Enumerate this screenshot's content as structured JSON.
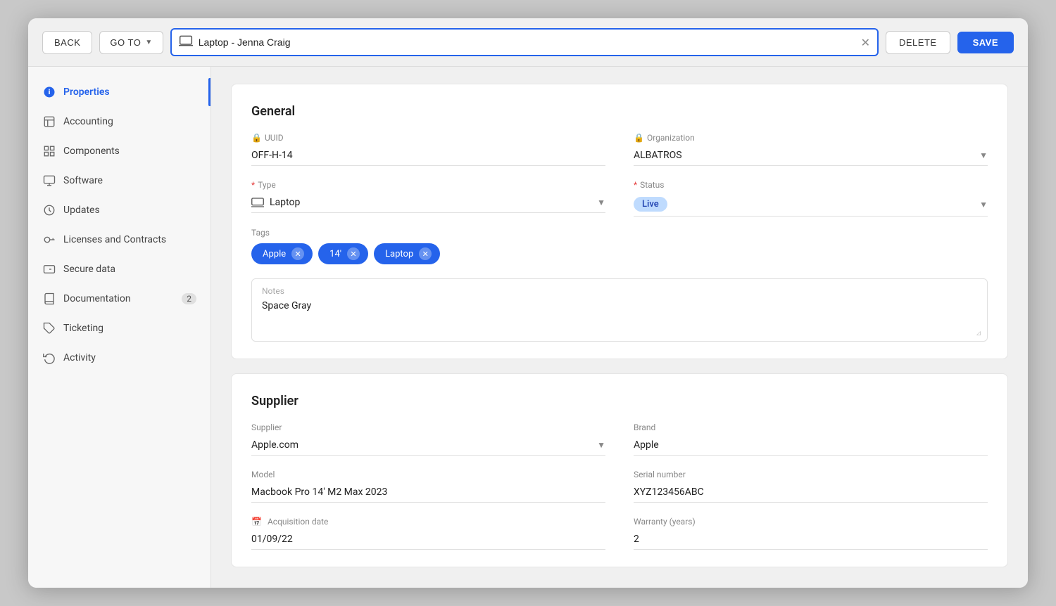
{
  "topbar": {
    "back_label": "BACK",
    "goto_label": "GO TO",
    "item_name": "Laptop - Jenna Craig",
    "delete_label": "DELETE",
    "save_label": "SAVE"
  },
  "sidebar": {
    "items": [
      {
        "id": "properties",
        "label": "Properties",
        "icon": "info-icon",
        "active": true,
        "badge": null
      },
      {
        "id": "accounting",
        "label": "Accounting",
        "icon": "calculator-icon",
        "active": false,
        "badge": null
      },
      {
        "id": "components",
        "label": "Components",
        "icon": "grid-icon",
        "active": false,
        "badge": null
      },
      {
        "id": "software",
        "label": "Software",
        "icon": "monitor-icon",
        "active": false,
        "badge": null
      },
      {
        "id": "updates",
        "label": "Updates",
        "icon": "clock-icon",
        "active": false,
        "badge": null
      },
      {
        "id": "licenses",
        "label": "Licenses and Contracts",
        "icon": "key-icon",
        "active": false,
        "badge": null
      },
      {
        "id": "secure-data",
        "label": "Secure data",
        "icon": "id-icon",
        "active": false,
        "badge": null
      },
      {
        "id": "documentation",
        "label": "Documentation",
        "icon": "book-icon",
        "active": false,
        "badge": "2"
      },
      {
        "id": "ticketing",
        "label": "Ticketing",
        "icon": "tag-icon",
        "active": false,
        "badge": null
      },
      {
        "id": "activity",
        "label": "Activity",
        "icon": "history-icon",
        "active": false,
        "badge": null
      }
    ]
  },
  "general": {
    "title": "General",
    "uuid_label": "UUID",
    "uuid_value": "OFF-H-14",
    "organization_label": "Organization",
    "organization_value": "ALBATROS",
    "type_label": "Type",
    "type_value": "Laptop",
    "status_label": "Status",
    "status_value": "Live",
    "tags_label": "Tags",
    "tags": [
      {
        "label": "Apple"
      },
      {
        "label": "14'"
      },
      {
        "label": "Laptop"
      }
    ],
    "notes_label": "Notes",
    "notes_value": "Space Gray"
  },
  "supplier": {
    "title": "Supplier",
    "supplier_label": "Supplier",
    "supplier_value": "Apple.com",
    "brand_label": "Brand",
    "brand_value": "Apple",
    "model_label": "Model",
    "model_value": "Macbook Pro 14' M2 Max 2023",
    "serial_label": "Serial number",
    "serial_value": "XYZ123456ABC",
    "acquisition_label": "Acquisition date",
    "acquisition_value": "01/09/22",
    "warranty_label": "Warranty (years)",
    "warranty_value": "2"
  }
}
